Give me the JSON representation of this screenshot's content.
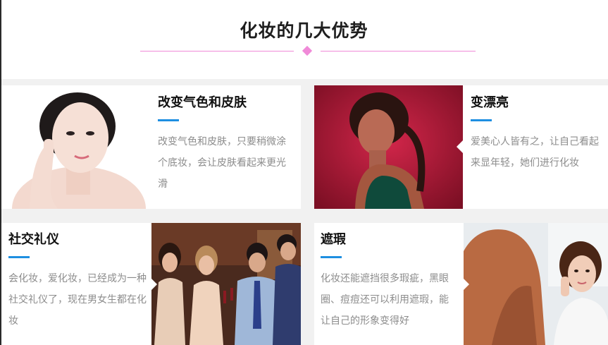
{
  "section": {
    "title": "化妆的几大优势",
    "accent_color": "#f08ad8",
    "bar_color": "#1e8fe1"
  },
  "cards": [
    {
      "title": "改变气色和皮肤",
      "desc": "改变气色和皮肤，只要稍微涂个底妆，会让皮肤看起来更光滑",
      "image": "woman-skin-portrait"
    },
    {
      "title": "变漂亮",
      "desc": "爱美心人皆有之，让自己看起来显年轻，她们进行化妆",
      "image": "woman-red-background"
    },
    {
      "title": "社交礼仪",
      "desc": "会化妆，爱化妆，已经成为一种社交礼仪了，现在男女生都在化妆",
      "image": "party-group-toast"
    },
    {
      "title": "遮瑕",
      "desc": "化妆还能遮挡很多瑕疵，黑眼圈、痘痘还可以利用遮瑕，能让自己的形象变得好",
      "image": "woman-mirror-makeup"
    }
  ]
}
